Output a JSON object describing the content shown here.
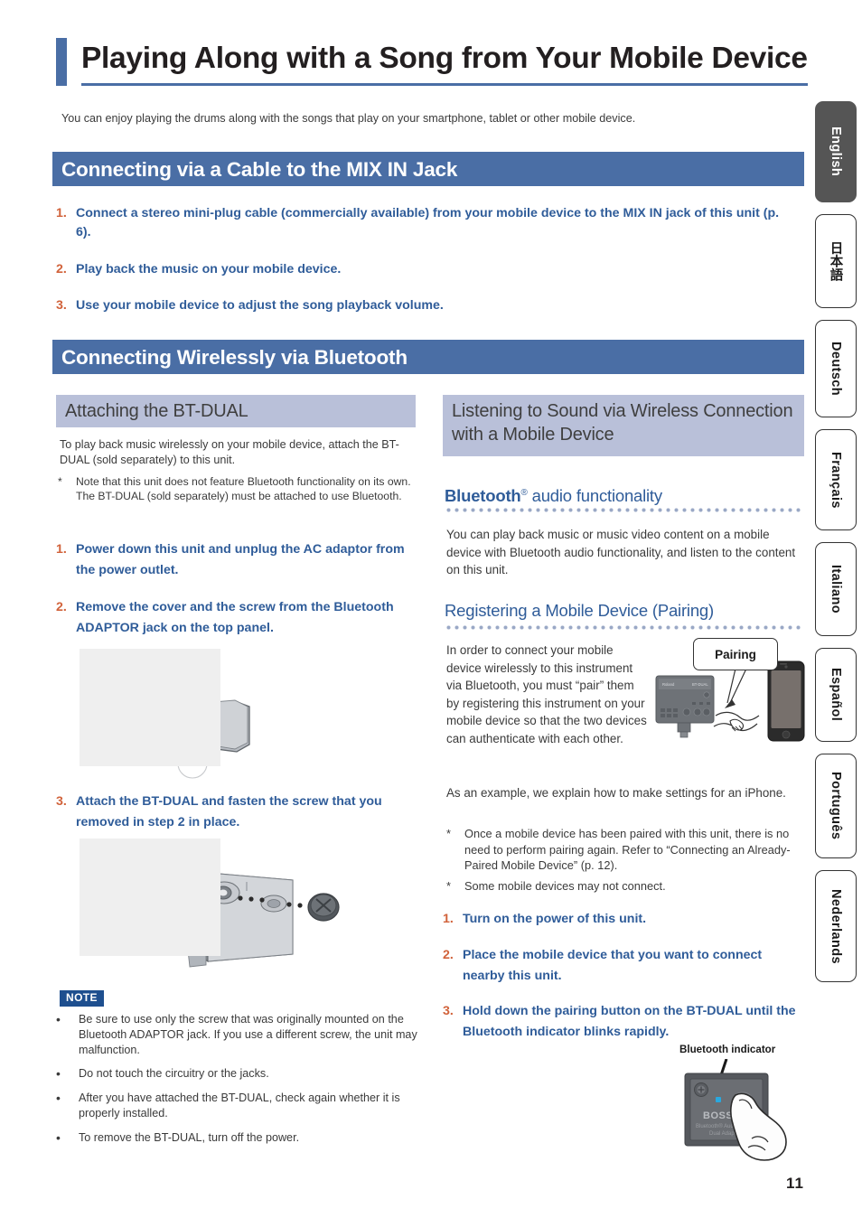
{
  "page": {
    "number": "11",
    "title": "Playing Along with a Song from Your Mobile Device",
    "intro": "You can enjoy playing the drums along with the songs that play on your smartphone, tablet or other mobile device."
  },
  "colors": {
    "header_blue": "#4a6ea5",
    "subheader_lavender": "#b9c0d9",
    "step_number_orange": "#d1623a",
    "step_text_blue": "#2f5c99",
    "note_badge_blue": "#1e4f8f",
    "indicator_led": "#29a8df"
  },
  "sections": {
    "mixin": {
      "heading": "Connecting via a Cable to the MIX IN Jack",
      "steps": [
        {
          "num": "1.",
          "text": "Connect a stereo mini-plug cable (commercially available) from your mobile device to the MIX IN jack of this unit (p. 6)."
        },
        {
          "num": "2.",
          "text": "Play back the music on your mobile device."
        },
        {
          "num": "3.",
          "text": "Use your mobile device to adjust the song playback volume."
        }
      ]
    },
    "bluetooth": {
      "heading": "Connecting Wirelessly via Bluetooth"
    }
  },
  "left_column": {
    "subheading": "Attaching the BT-DUAL",
    "intro": "To play back music wirelessly on your mobile device, attach the BT-DUAL (sold separately) to this unit.",
    "asterisk_note": {
      "mark": "*",
      "text": "Note that this unit does not feature Bluetooth functionality on its own. The BT-DUAL (sold separately) must be attached to use Bluetooth."
    },
    "steps": [
      {
        "num": "1.",
        "text": "Power down this unit and unplug the AC adaptor from the power outlet."
      },
      {
        "num": "2.",
        "text": "Remove the cover and the screw from the Bluetooth ADAPTOR jack on the top panel."
      },
      {
        "num": "3.",
        "text": "Attach the BT-DUAL and fasten the screw that you removed in step 2 in place."
      }
    ],
    "figures": [
      {
        "name": "adaptor-jack-cover-removal-figure"
      },
      {
        "name": "bt-dual-attach-screw-figure"
      }
    ],
    "note": {
      "badge": "NOTE",
      "bullets": [
        "Be sure to use only the screw that was originally mounted on the Bluetooth ADAPTOR jack. If you use a different screw, the unit may malfunction.",
        "Do not touch the circuitry or the jacks.",
        "After you have attached the BT-DUAL, check again whether it is properly installed.",
        "To remove the BT-DUAL, turn off the power."
      ]
    }
  },
  "right_column": {
    "subheading": "Listening to Sound via Wireless Connection with a Mobile Device",
    "audio_functionality": {
      "heading_bold": "Bluetooth",
      "heading_sup": "®",
      "heading_rest": " audio functionality",
      "body": "You can play back music or music video content on a mobile device with Bluetooth audio functionality, and listen to the content on this unit."
    },
    "pairing": {
      "heading": "Registering a Mobile Device (Pairing)",
      "body": "In order to connect your mobile device wirelessly to this instrument via Bluetooth, you must “pair” them by registering this instrument on your mobile device so that the two devices can authenticate with each other.",
      "callout_label": "Pairing",
      "example": "As an example, we explain how to make settings for an iPhone.",
      "asterisks": [
        {
          "mark": "*",
          "text": "Once a mobile device has been paired with this unit, there is no need to perform pairing again. Refer to “Connecting an Already-Paired Mobile Device” (p. 12)."
        },
        {
          "mark": "*",
          "text": "Some mobile devices may not connect."
        }
      ],
      "steps": [
        {
          "num": "1.",
          "text": "Turn on the power of this unit."
        },
        {
          "num": "2.",
          "text": "Place the mobile device that you want to connect nearby this unit."
        },
        {
          "num": "3.",
          "text": "Hold down the pairing button on the BT-DUAL until the Bluetooth indicator blinks rapidly."
        }
      ],
      "indicator_label": "Bluetooth indicator",
      "device_brand": "BOSS",
      "device_caption_line1": "Bluetooth® Audio MIDI",
      "device_caption_line2": "Dual Adaptor"
    }
  },
  "language_tabs": [
    {
      "label": "English",
      "active": true
    },
    {
      "label": "日本語",
      "active": false
    },
    {
      "label": "Deutsch",
      "active": false
    },
    {
      "label": "Français",
      "active": false
    },
    {
      "label": "Italiano",
      "active": false
    },
    {
      "label": "Español",
      "active": false
    },
    {
      "label": "Português",
      "active": false
    },
    {
      "label": "Nederlands",
      "active": false
    }
  ]
}
